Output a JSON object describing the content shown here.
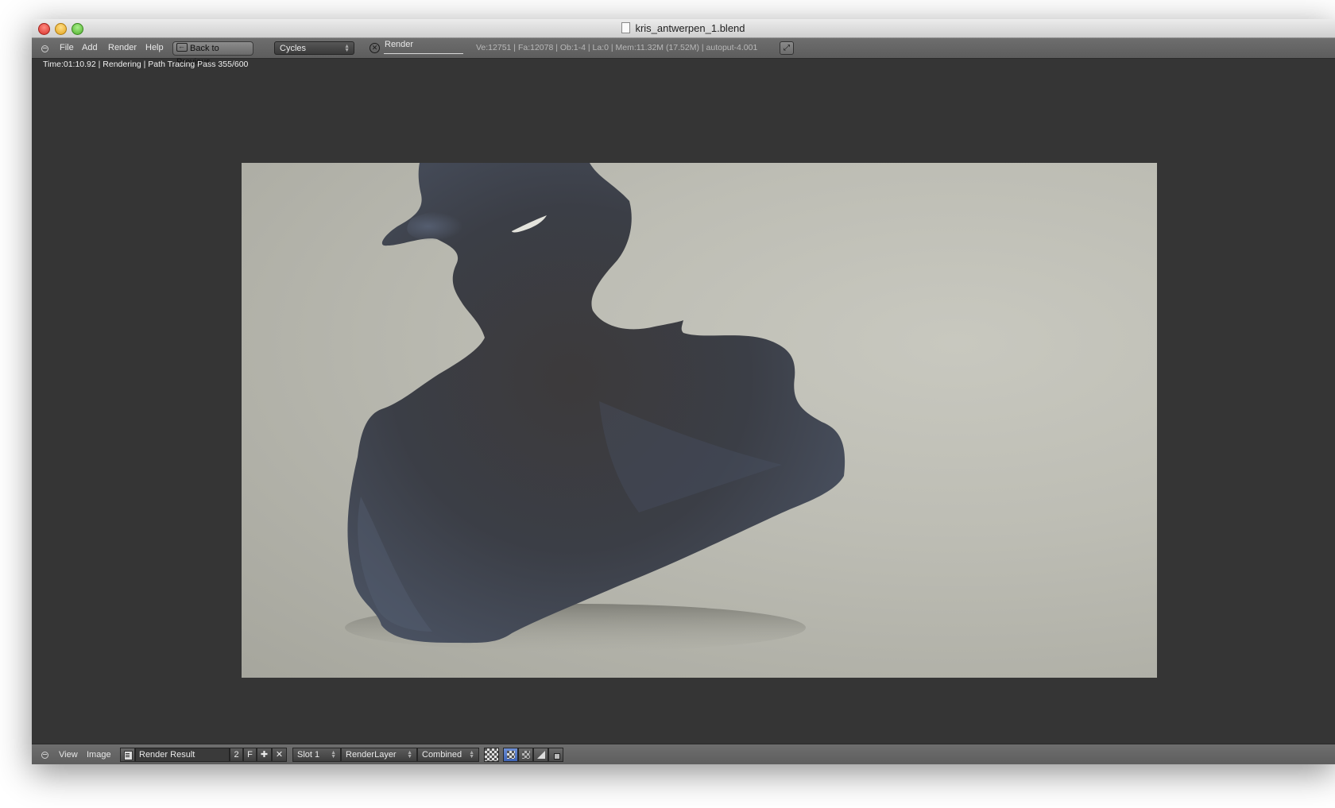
{
  "window": {
    "title": "kris_antwerpen_1.blend"
  },
  "header": {
    "menu": [
      "File",
      "Add",
      "Render",
      "Help"
    ],
    "back_button": "Back to Previous",
    "engine": "Cycles",
    "scene_name": "Render",
    "stats": "Ve:12751 | Fa:12078 | Ob:1-4 | La:0 | Mem:11.32M (17.52M) | autoput-4.001"
  },
  "status": {
    "text": "Time:01:10.92 | Rendering | Path Tracing Pass 355/600"
  },
  "footer": {
    "menu": [
      "View",
      "Image"
    ],
    "image_name": "Render Result",
    "users": "2",
    "fake_user": "F",
    "slot": "Slot 1",
    "layer": "RenderLayer",
    "pass": "Combined"
  },
  "icons": {
    "traffic_lights": [
      "close-icon",
      "minimize-icon",
      "maximize-icon"
    ],
    "header": [
      "collapse-icon",
      "back-icon",
      "close-x-icon",
      "fullscreen-icon"
    ],
    "footer": [
      "collapse-icon",
      "image-icon",
      "new-image-icon",
      "unlink-icon",
      "alpha-checker-icon",
      "checker-icon",
      "alpha-icon",
      "z-buffer-icon",
      "display-channels-icon"
    ]
  },
  "colors": {
    "window_bg": "#353535",
    "header_bg": "#666666",
    "render_bg": "#c2c2b9",
    "sculpture": "#3a3c42"
  }
}
